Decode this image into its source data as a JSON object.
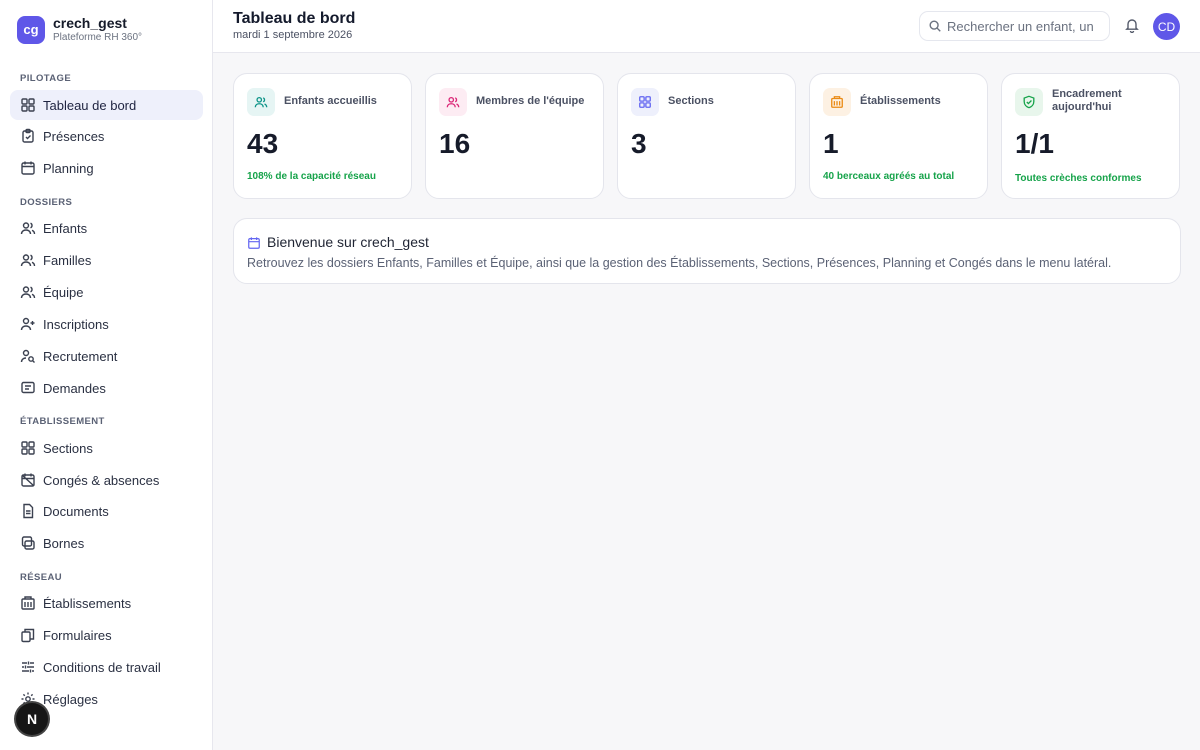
{
  "brand": {
    "logo": "cg",
    "name": "crech_gest",
    "subtitle": "Plateforme RH 360°"
  },
  "sidebar": {
    "sections": [
      {
        "title": "PILOTAGE",
        "items": [
          {
            "label": "Tableau de bord",
            "icon": "grid-icon",
            "active": true
          },
          {
            "label": "Présences",
            "icon": "clipboard-icon"
          },
          {
            "label": "Planning",
            "icon": "calendar-icon"
          }
        ]
      },
      {
        "title": "DOSSIERS",
        "items": [
          {
            "label": "Enfants",
            "icon": "users-icon"
          },
          {
            "label": "Familles",
            "icon": "users-icon"
          },
          {
            "label": "Équipe",
            "icon": "team-icon"
          },
          {
            "label": "Inscriptions",
            "icon": "user-plus-icon"
          },
          {
            "label": "Recrutement",
            "icon": "user-search-icon"
          },
          {
            "label": "Demandes",
            "icon": "message-icon"
          }
        ]
      },
      {
        "title": "ÉTABLISSEMENT",
        "items": [
          {
            "label": "Sections",
            "icon": "grid-icon"
          },
          {
            "label": "Congés & absences",
            "icon": "calendar-off-icon"
          },
          {
            "label": "Documents",
            "icon": "document-icon"
          },
          {
            "label": "Bornes",
            "icon": "tablet-icon"
          }
        ]
      },
      {
        "title": "RÉSEAU",
        "items": [
          {
            "label": "Établissements",
            "icon": "building-icon"
          },
          {
            "label": "Formulaires",
            "icon": "forms-icon"
          },
          {
            "label": "Conditions de travail",
            "icon": "sliders-icon"
          },
          {
            "label": "Réglages",
            "icon": "gear-icon"
          }
        ]
      }
    ]
  },
  "header": {
    "title": "Tableau de bord",
    "date": "mardi 1 septembre 2026",
    "search_placeholder": "Rechercher un enfant, un e",
    "avatar": "CD"
  },
  "stats": [
    {
      "label": "Enfants accueillis",
      "value": "43",
      "note": "108% de la capacité réseau",
      "icon": "users-icon",
      "accent": "#0d9488",
      "tint": "#e6f5f4"
    },
    {
      "label": "Membres de l'équipe",
      "value": "16",
      "note": "",
      "icon": "users-icon",
      "accent": "#db2777",
      "tint": "#fdecf3"
    },
    {
      "label": "Sections",
      "value": "3",
      "note": "",
      "icon": "grid-icon",
      "accent": "#6366f1",
      "tint": "#eef0fc"
    },
    {
      "label": "Établissements",
      "value": "1",
      "note": "40 berceaux agréés au total",
      "icon": "building-icon",
      "accent": "#ea8a14",
      "tint": "#fdf1e3"
    },
    {
      "label": "Encadrement aujourd'hui",
      "value": "1/1",
      "note": "Toutes crèches conformes",
      "icon": "shield-check-icon",
      "accent": "#16a34a",
      "tint": "#e8f6ec"
    }
  ],
  "welcome": {
    "title": "Bienvenue sur crech_gest",
    "text": "Retrouvez les dossiers Enfants, Familles et Équipe, ainsi que la gestion des Établissements, Sections, Présences, Planning et Congés dans le menu latéral."
  },
  "dev_badge": "N"
}
